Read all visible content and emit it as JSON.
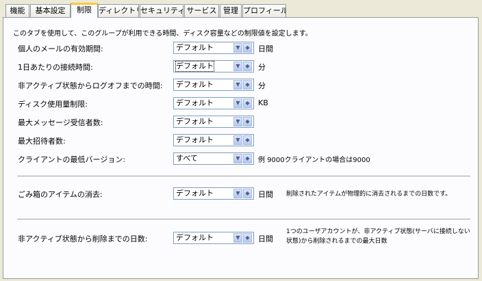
{
  "tabs": [
    {
      "label": "機能"
    },
    {
      "label": "基本設定"
    },
    {
      "label": "制限"
    },
    {
      "label": "ディレクトリ"
    },
    {
      "label": "セキュリティ"
    },
    {
      "label": "サービス"
    },
    {
      "label": "管理"
    },
    {
      "label": "プロフィール"
    }
  ],
  "intro": "このタブを使用して、このグループが利用できる時間、ディスク容量などの制限値を設定します。",
  "settings": [
    {
      "label": "個人のメールの有効期間:",
      "value": "デフォルト",
      "unit": "日間"
    },
    {
      "label": "1日あたりの接続時間:",
      "value": "デフォルト",
      "unit": "分"
    },
    {
      "label": "非アクティブ状態からログオフまでの時間:",
      "value": "デフォルト",
      "unit": "分"
    },
    {
      "label": "ディスク使用量制限:",
      "value": "デフォルト",
      "unit": "KB"
    },
    {
      "label": "最大メッセージ受信者数:",
      "value": "デフォルト",
      "unit": ""
    },
    {
      "label": "最大招待者数:",
      "value": "デフォルト",
      "unit": ""
    },
    {
      "label": "クライアントの最低バージョン:",
      "value": "すべて",
      "unit": "例 9000クライアントの場合は9000"
    },
    {
      "label": "ごみ箱のアイテムの消去:",
      "value": "デフォルト",
      "unit": "日間",
      "note": "削除されたアイテムが物理的に消去されるまでの日数です。"
    },
    {
      "label": "非アクティブ状態から削除までの日数:",
      "value": "デフォルト",
      "unit": "日間",
      "note": "1つのユーザアカウントが、非アクティブ状態(サーバに接続しない状態)から削除されるまでの最大日数"
    }
  ],
  "spin_icons": {
    "up_down": "chevron-updown-icon"
  }
}
